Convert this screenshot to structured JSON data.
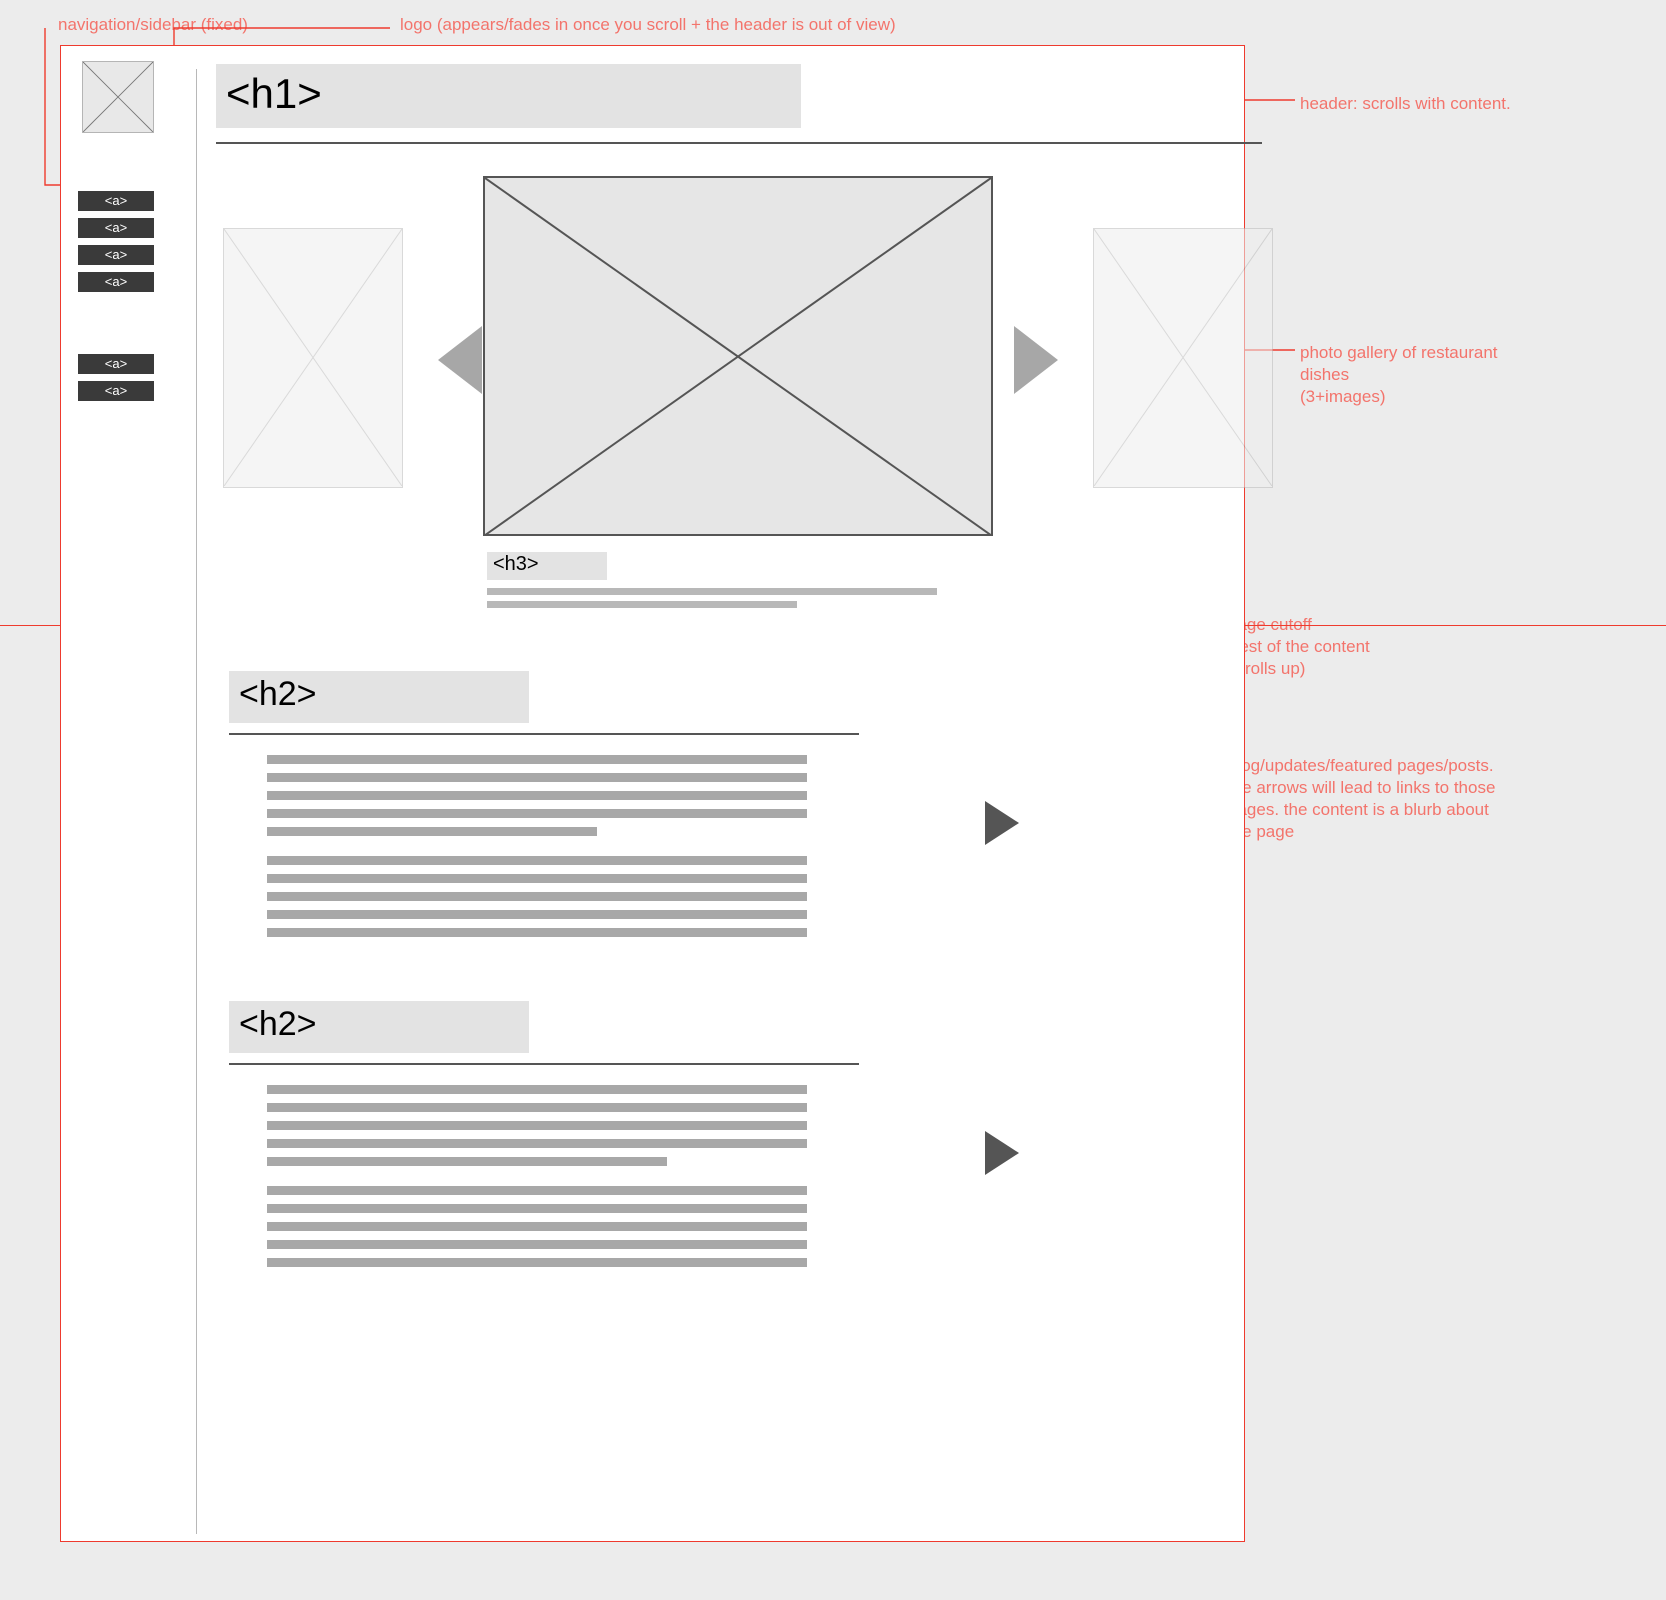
{
  "annotations": {
    "sidebar": "navigation/sidebar (fixed)",
    "logo": "logo (appears/fades in once you scroll + the header is out of view)",
    "header": "header: scrolls with content.",
    "gallery": "photo gallery of restaurant dishes\n   (3+images)",
    "cutoff": "page cutoff\n(rest of the content\n   scrolls up)",
    "posts": "blog/updates/featured pages/posts. the arrows will lead to links to those pages. the content is a blurb about the page"
  },
  "wireframe": {
    "h1": "<h1>",
    "nav_group_1": [
      "<a>",
      "<a>",
      "<a>",
      "<a>"
    ],
    "nav_group_2": [
      "<a>",
      "<a>"
    ],
    "gallery_caption_heading": "<h3>",
    "posts": [
      {
        "heading": "<h2>"
      },
      {
        "heading": "<h2>"
      }
    ]
  }
}
